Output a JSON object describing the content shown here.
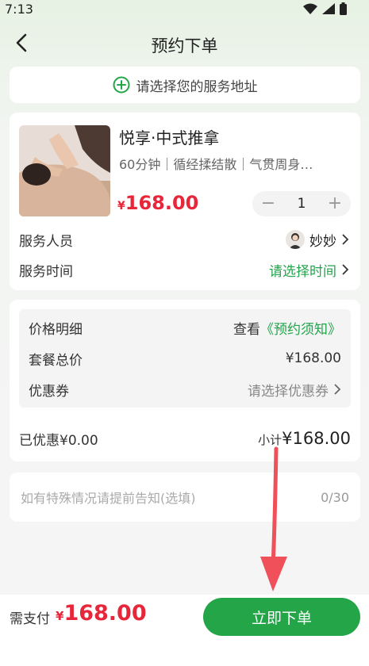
{
  "status": {
    "time": "7:13"
  },
  "nav": {
    "title": "预约下单"
  },
  "address": {
    "placeholder": "请选择您的服务地址"
  },
  "product": {
    "name": "悦享·中式推拿",
    "tags": "60分钟｜循经揉结散｜气贯周身…",
    "currency": "¥",
    "price": "168.00",
    "quantity": "1",
    "minus": "−",
    "plus": "+"
  },
  "staff": {
    "label": "服务人员",
    "name": "妙妙"
  },
  "service_time": {
    "label": "服务时间",
    "value": "请选择时间"
  },
  "price_detail": {
    "title": "价格明细",
    "view_prefix": "查看",
    "view_link": "《预约须知》",
    "package_label": "套餐总价",
    "package_value": "¥168.00",
    "coupon_label": "优惠券",
    "coupon_value": "请选择优惠券",
    "discount": "已优惠¥0.00",
    "subtotal_label": "小计",
    "subtotal_value": "¥168.00"
  },
  "note": {
    "placeholder": "如有特殊情况请提前告知(选填)",
    "count": "0/30"
  },
  "footer": {
    "pay_label": "需支付",
    "currency": "¥",
    "total": "168.00",
    "button": "立即下单"
  },
  "colors": {
    "accent": "#23a548",
    "price": "#e7263a"
  }
}
